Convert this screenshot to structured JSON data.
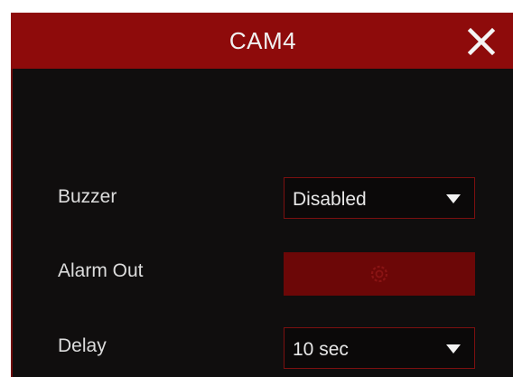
{
  "dialog": {
    "title": "CAM4"
  },
  "settings": {
    "buzzer": {
      "label": "Buzzer",
      "value": "Disabled"
    },
    "alarm_out": {
      "label": "Alarm Out",
      "button_icon": "gear-icon"
    },
    "delay": {
      "label": "Delay",
      "value": "10 sec"
    }
  },
  "colors": {
    "title_bar": "#8e0b0b",
    "panel_background": "#100e0e",
    "select_border": "#7c1010",
    "setup_button": "#6c0707"
  }
}
